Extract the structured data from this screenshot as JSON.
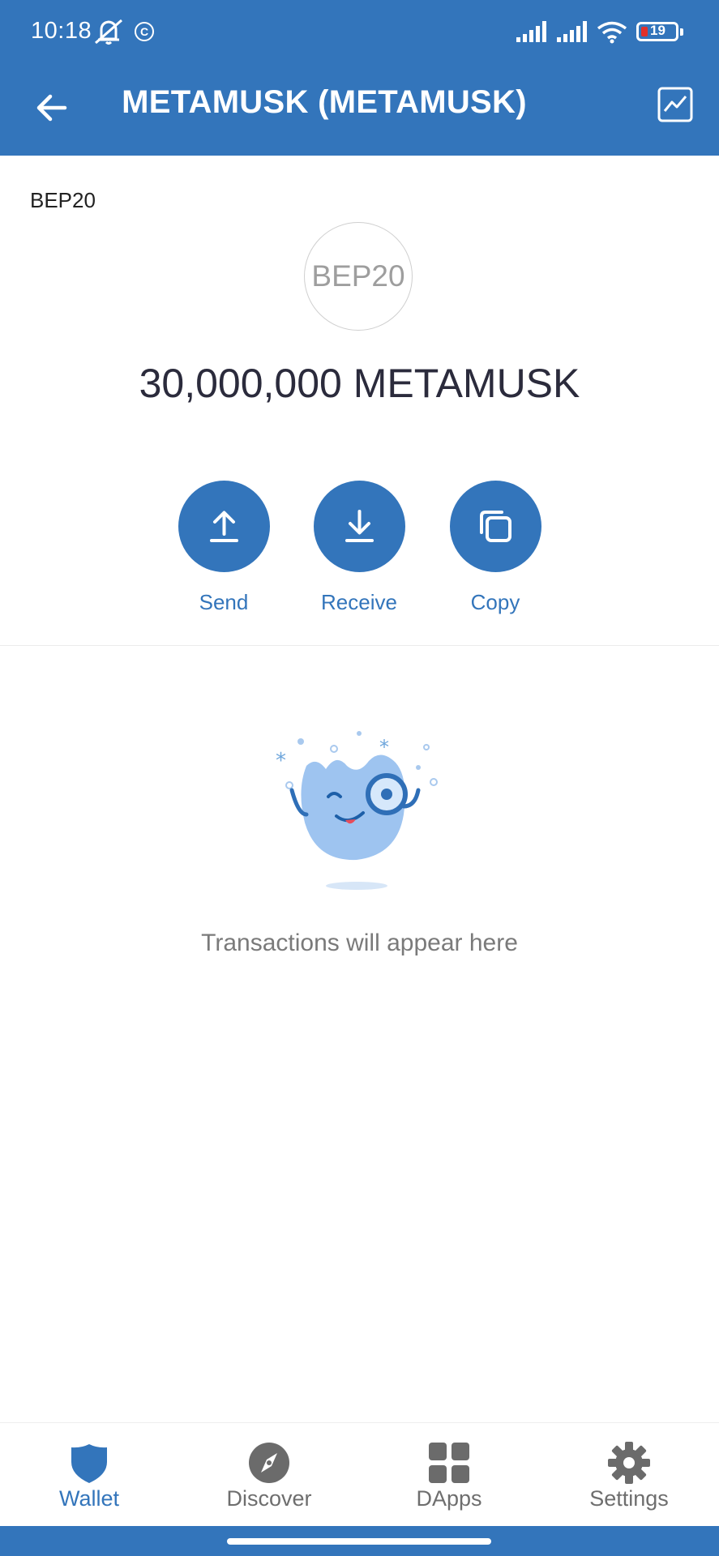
{
  "status_bar": {
    "time": "10:18",
    "battery": "19",
    "icons": [
      "bell-muted-icon",
      "c-icon",
      "signal-icon",
      "signal-icon",
      "wifi-icon",
      "battery-icon"
    ]
  },
  "header": {
    "title": "METAMUSK (METAMUSK)",
    "back_icon": "arrow-left-icon",
    "chart_icon": "chart-icon",
    "background": "#3375BB"
  },
  "token": {
    "network": "BEP20",
    "logo_text": "BEP20",
    "balance": "30,000,000 METAMUSK"
  },
  "actions": [
    {
      "label": "Send",
      "icon": "upload-icon"
    },
    {
      "label": "Receive",
      "icon": "download-icon"
    },
    {
      "label": "Copy",
      "icon": "copy-icon"
    }
  ],
  "empty_state": {
    "illustration": "search-mascot-illustration",
    "text": "Transactions will appear here"
  },
  "bottom_nav": [
    {
      "label": "Wallet",
      "icon": "shield-icon",
      "active": true
    },
    {
      "label": "Discover",
      "icon": "compass-icon",
      "active": false
    },
    {
      "label": "DApps",
      "icon": "grid-icon",
      "active": false
    },
    {
      "label": "Settings",
      "icon": "gear-icon",
      "active": false
    }
  ],
  "colors": {
    "accent": "#3375BB",
    "text_dark": "#2b2b3c",
    "text_muted": "#7a7a7a"
  }
}
